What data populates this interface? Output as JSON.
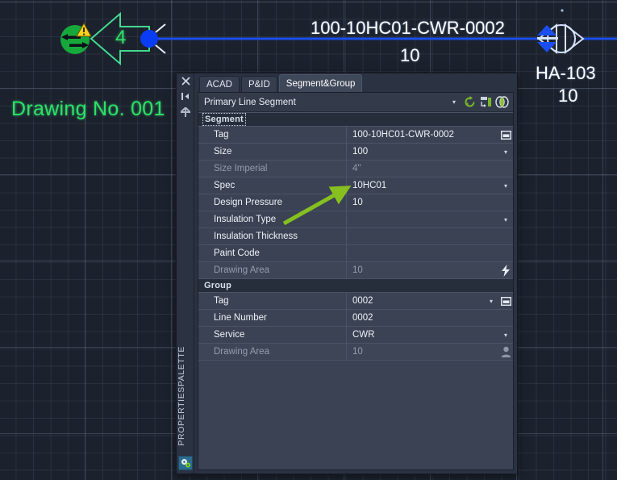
{
  "drawing": {
    "title": "Drawing No. 001",
    "arrow_label": "4",
    "line_tag": "100-10HC01-CWR-0002",
    "line_sub": "10",
    "valve_tag": "HA-103",
    "valve_sub": "10",
    "icons": {
      "sync_warning": "sync-warning-icon",
      "grip": "grip-node-icon",
      "valve": "butterfly-valve-icon",
      "offpage_connector": "offpage-connector-arrow-icon"
    },
    "colors": {
      "background": "#1c222d",
      "grid_minor": "#2b3343",
      "grid_major": "#3b455a",
      "pipe": "#1b4ef0",
      "symbol": "#d6e2ff",
      "green": "#2fe06a",
      "annotation_arrow": "#86c020"
    }
  },
  "palette": {
    "strip_title": "PROPERTIESPALETTE",
    "strip_icons": [
      {
        "name": "close-icon",
        "glyph": "✕"
      },
      {
        "name": "auto-hide-icon",
        "glyph": "▐◀"
      },
      {
        "name": "palette-settings-icon",
        "glyph": "✸"
      }
    ],
    "bottom_icon": "properties-gears-icon",
    "tabs": [
      {
        "label": "ACAD",
        "active": false
      },
      {
        "label": "P&ID",
        "active": false
      },
      {
        "label": "Segment&Group",
        "active": true
      }
    ],
    "selector": {
      "value": "Primary Line Segment",
      "caret": "▾",
      "tools": [
        {
          "name": "refresh-icon"
        },
        {
          "name": "quick-select-icon"
        },
        {
          "name": "toggle-view-icon"
        }
      ]
    },
    "categories": [
      {
        "name": "Segment",
        "focused": true,
        "rows": [
          {
            "label": "Tag",
            "value": "100-10HC01-CWR-0002",
            "dim": false,
            "caret": false,
            "icon": "pick-window-icon"
          },
          {
            "label": "Size",
            "value": "100",
            "dim": false,
            "caret": true,
            "icon": ""
          },
          {
            "label": "Size Imperial",
            "value": "4\"",
            "dim": true,
            "caret": false,
            "icon": ""
          },
          {
            "label": "Spec",
            "value": "10HC01",
            "dim": false,
            "caret": true,
            "icon": ""
          },
          {
            "label": "Design Pressure",
            "value": "10",
            "dim": false,
            "caret": false,
            "icon": ""
          },
          {
            "label": "Insulation Type",
            "value": "",
            "dim": false,
            "caret": true,
            "icon": ""
          },
          {
            "label": "Insulation Thickness",
            "value": "",
            "dim": false,
            "caret": false,
            "icon": ""
          },
          {
            "label": "Paint Code",
            "value": "",
            "dim": false,
            "caret": false,
            "icon": ""
          },
          {
            "label": "Drawing Area",
            "value": "10",
            "dim": true,
            "caret": false,
            "icon": "lightning-icon"
          }
        ]
      },
      {
        "name": "Group",
        "focused": false,
        "rows": [
          {
            "label": "Tag",
            "value": "0002",
            "dim": false,
            "caret": true,
            "icon": "pick-window-icon"
          },
          {
            "label": "Line Number",
            "value": "0002",
            "dim": false,
            "caret": false,
            "icon": ""
          },
          {
            "label": "Service",
            "value": "CWR",
            "dim": false,
            "caret": true,
            "icon": ""
          },
          {
            "label": "Drawing Area",
            "value": "10",
            "dim": true,
            "caret": false,
            "icon": "person-icon"
          }
        ]
      }
    ]
  }
}
